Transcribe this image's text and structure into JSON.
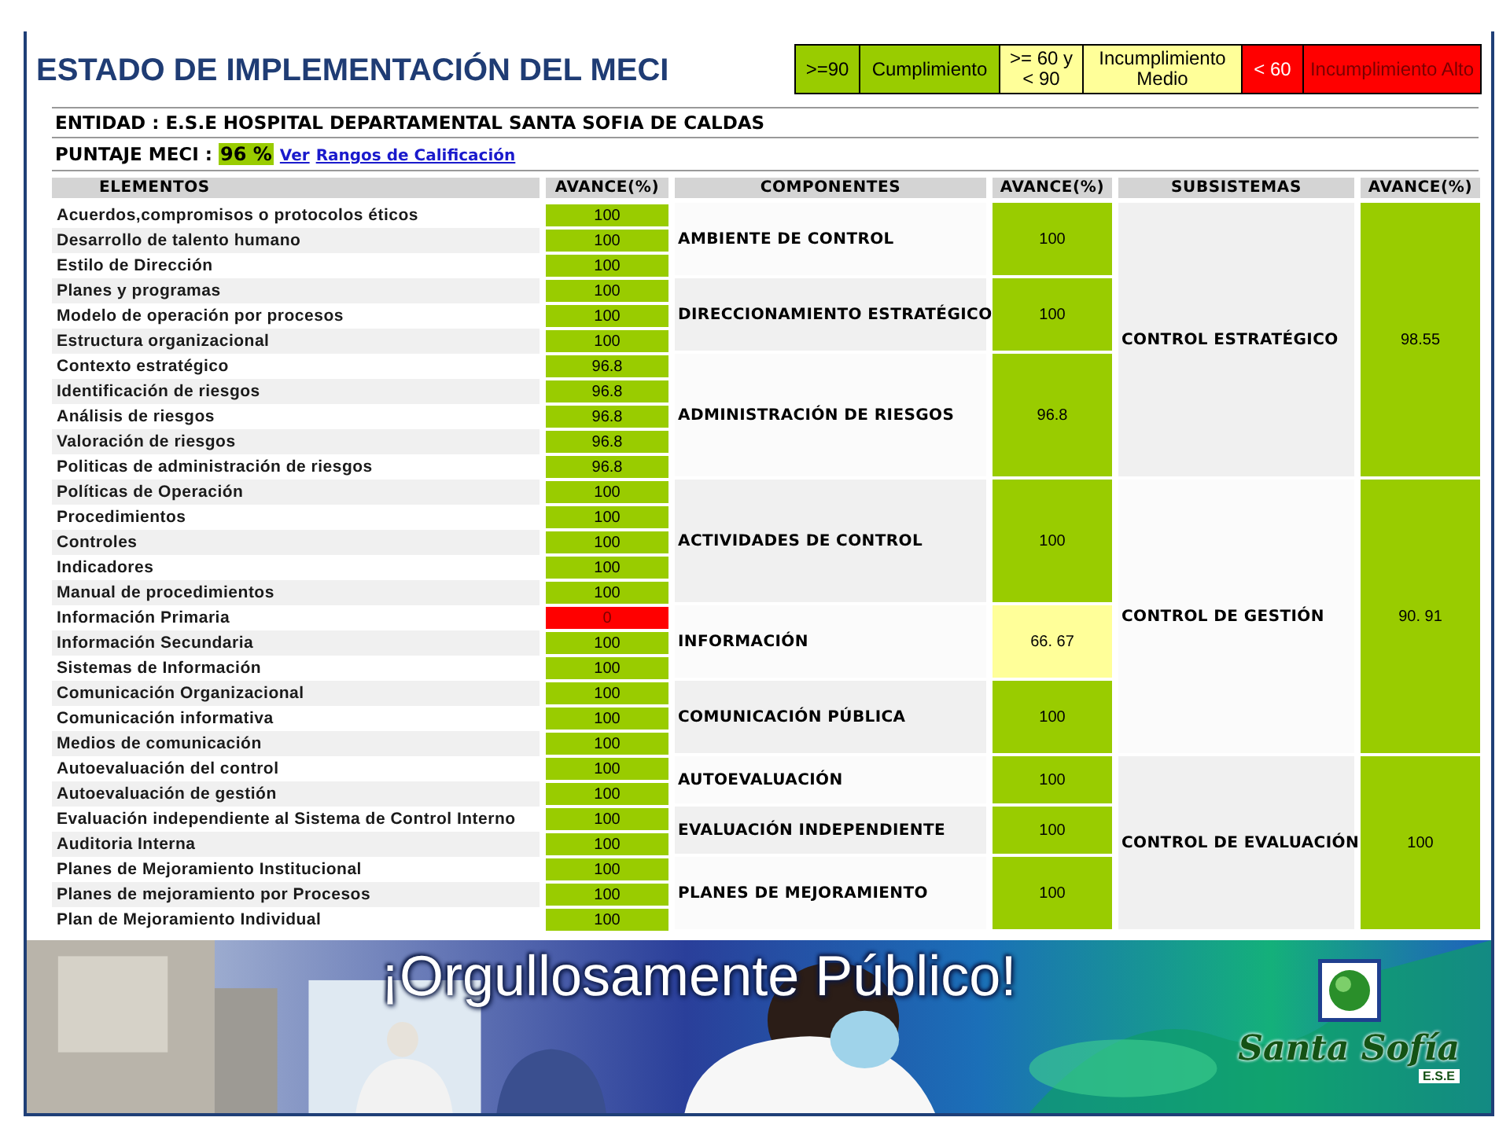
{
  "slide_title": "ESTADO DE IMPLEMENTACIÓN DEL MECI",
  "legend": [
    {
      "range": ">=90",
      "label": "Cumplimiento",
      "color": "#99cc00"
    },
    {
      "range": ">= 60 y < 90",
      "label": "Incumplimiento Medio",
      "color": "#ffff99"
    },
    {
      "range": "< 60",
      "label": "Incumplimiento Alto",
      "color": "#ff0000"
    }
  ],
  "entity": "ENTIDAD : E.S.E HOSPITAL DEPARTAMENTAL SANTA SOFIA DE CALDAS",
  "score": {
    "label": "PUNTAJE MECI :",
    "value": "96 %",
    "color": "#99cc00",
    "links": [
      "Ver",
      "Rangos de Calificación"
    ]
  },
  "table": {
    "columns": [
      "ELEMENTOS",
      "AVANCE(%)",
      "COMPONENTES",
      "AVANCE(%)",
      "SUBSISTEMAS",
      "AVANCE(%)"
    ],
    "subsystems": [
      {
        "name": "CONTROL ESTRATÉGICO",
        "avance": "98.55",
        "color": "#99cc00",
        "components": [
          {
            "name": "AMBIENTE DE CONTROL",
            "avance": "100",
            "color": "#99cc00",
            "elements": [
              {
                "name": "Acuerdos,compromisos o protocolos éticos",
                "avance": "100",
                "color": "#99cc00"
              },
              {
                "name": "Desarrollo de talento humano",
                "avance": "100",
                "color": "#99cc00"
              },
              {
                "name": "Estilo de Dirección",
                "avance": "100",
                "color": "#99cc00"
              }
            ]
          },
          {
            "name": "DIRECCIONAMIENTO ESTRATÉGICO",
            "avance": "100",
            "color": "#99cc00",
            "elements": [
              {
                "name": "Planes y programas",
                "avance": "100",
                "color": "#99cc00"
              },
              {
                "name": "Modelo de operación por procesos",
                "avance": "100",
                "color": "#99cc00"
              },
              {
                "name": "Estructura organizacional",
                "avance": "100",
                "color": "#99cc00"
              }
            ]
          },
          {
            "name": "ADMINISTRACIÓN DE RIESGOS",
            "avance": "96.8",
            "color": "#99cc00",
            "elements": [
              {
                "name": "Contexto estratégico",
                "avance": "96.8",
                "color": "#99cc00"
              },
              {
                "name": "Identificación de riesgos",
                "avance": "96.8",
                "color": "#99cc00"
              },
              {
                "name": "Análisis de riesgos",
                "avance": "96.8",
                "color": "#99cc00"
              },
              {
                "name": "Valoración de riesgos",
                "avance": "96.8",
                "color": "#99cc00"
              },
              {
                "name": "Politicas de administración de riesgos",
                "avance": "96.8",
                "color": "#99cc00"
              }
            ]
          }
        ]
      },
      {
        "name": "CONTROL DE GESTIÓN",
        "avance": "90. 91",
        "color": "#99cc00",
        "components": [
          {
            "name": "ACTIVIDADES DE CONTROL",
            "avance": "100",
            "color": "#99cc00",
            "elements": [
              {
                "name": "Políticas de Operación",
                "avance": "100",
                "color": "#99cc00"
              },
              {
                "name": "Procedimientos",
                "avance": "100",
                "color": "#99cc00"
              },
              {
                "name": "Controles",
                "avance": "100",
                "color": "#99cc00"
              },
              {
                "name": "Indicadores",
                "avance": "100",
                "color": "#99cc00"
              },
              {
                "name": "Manual de procedimientos",
                "avance": "100",
                "color": "#99cc00"
              }
            ]
          },
          {
            "name": "INFORMACIÓN",
            "avance": "66. 67",
            "color": "#ffff99",
            "elements": [
              {
                "name": "Información Primaria",
                "avance": "0",
                "color": "#ff0000"
              },
              {
                "name": "Información Secundaria",
                "avance": "100",
                "color": "#99cc00"
              },
              {
                "name": "Sistemas de Información",
                "avance": "100",
                "color": "#99cc00"
              }
            ]
          },
          {
            "name": "COMUNICACIÓN PÚBLICA",
            "avance": "100",
            "color": "#99cc00",
            "elements": [
              {
                "name": "Comunicación Organizacional",
                "avance": "100",
                "color": "#99cc00"
              },
              {
                "name": "Comunicación informativa",
                "avance": "100",
                "color": "#99cc00"
              },
              {
                "name": "Medios de comunicación",
                "avance": "100",
                "color": "#99cc00"
              }
            ]
          }
        ]
      },
      {
        "name": "CONTROL DE EVALUACIÓN",
        "avance": "100",
        "color": "#99cc00",
        "components": [
          {
            "name": "AUTOEVALUACIÓN",
            "avance": "100",
            "color": "#99cc00",
            "elements": [
              {
                "name": "Autoevaluación del control",
                "avance": "100",
                "color": "#99cc00"
              },
              {
                "name": "Autoevaluación de gestión",
                "avance": "100",
                "color": "#99cc00"
              }
            ]
          },
          {
            "name": "EVALUACIÓN INDEPENDIENTE",
            "avance": "100",
            "color": "#99cc00",
            "elements": [
              {
                "name": "Evaluación independiente al Sistema de Control Interno",
                "avance": "100",
                "color": "#99cc00"
              },
              {
                "name": "Auditoria Interna",
                "avance": "100",
                "color": "#99cc00"
              }
            ]
          },
          {
            "name": "PLANES DE MEJORAMIENTO",
            "avance": "100",
            "color": "#99cc00",
            "elements": [
              {
                "name": "Planes de Mejoramiento Institucional",
                "avance": "100",
                "color": "#99cc00"
              },
              {
                "name": "Planes de mejoramiento por Procesos",
                "avance": "100",
                "color": "#99cc00"
              },
              {
                "name": "Plan de Mejoramiento Individual",
                "avance": "100",
                "color": "#99cc00"
              }
            ]
          }
        ]
      }
    ]
  },
  "banner": {
    "slogan": "¡Orgullosamente Público!",
    "logo_name": "Santa Sofía",
    "logo_sub": "E.S.E"
  }
}
